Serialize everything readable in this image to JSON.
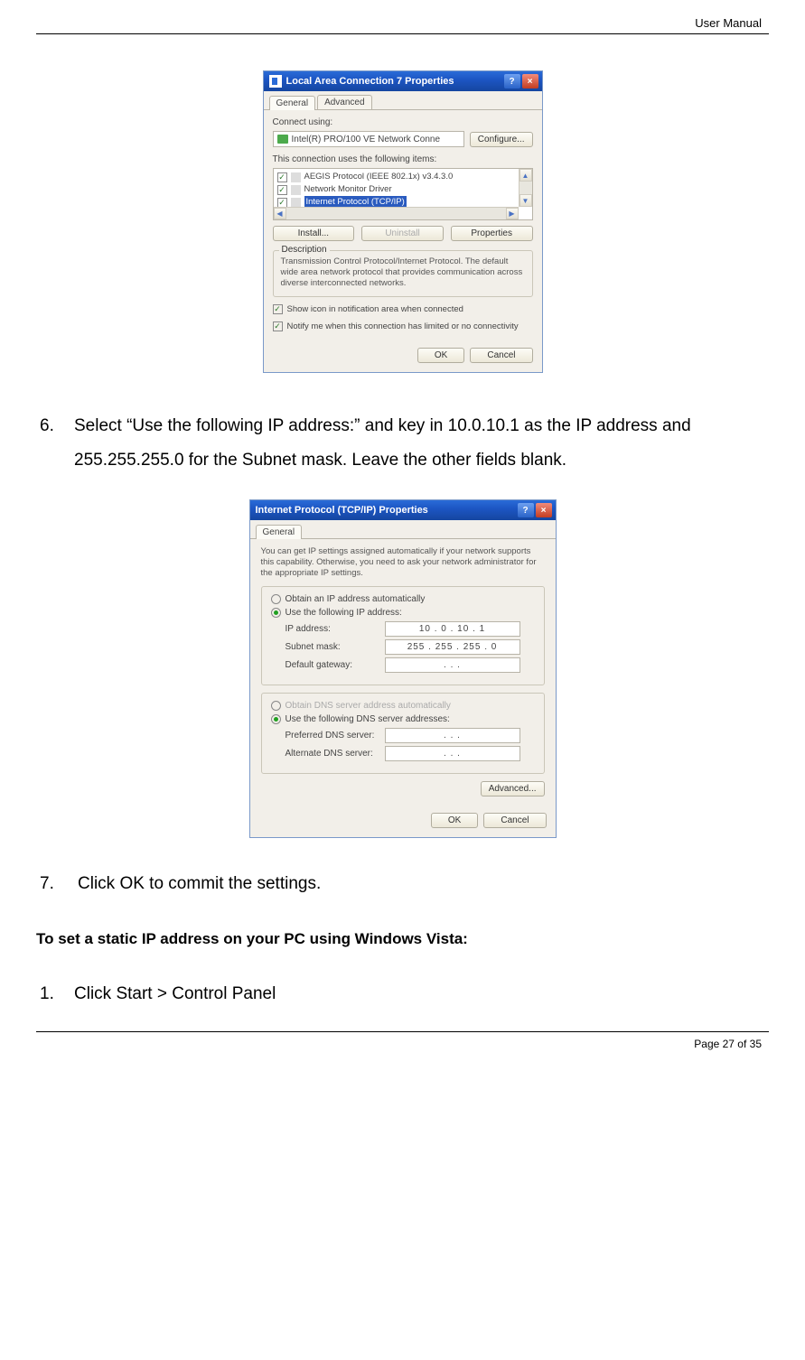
{
  "header": {
    "doc_title": "User Manual"
  },
  "footer": {
    "page_label": "Page 27 of 35"
  },
  "steps": {
    "six": {
      "num": "6.",
      "text": "Select “Use the following IP address:” and key in 10.0.10.1 as the IP address and 255.255.255.0 for the Subnet mask. Leave the other fields blank."
    },
    "seven": {
      "num": "7.",
      "text": "Click OK to commit the settings."
    },
    "one": {
      "num": "1.",
      "text": "Click Start > Control Panel"
    }
  },
  "section_heading": "To set a static IP address on your PC using Windows Vista:",
  "dialog1": {
    "title": "Local Area Connection 7 Properties",
    "help_glyph": "?",
    "close_glyph": "×",
    "tabs": {
      "general": "General",
      "advanced": "Advanced"
    },
    "connect_using_label": "Connect using:",
    "nic_text": "Intel(R) PRO/100 VE Network Conne",
    "configure_btn": "Configure...",
    "uses_items_label": "This connection uses the following items:",
    "items": {
      "a": "AEGIS Protocol (IEEE 802.1x) v3.4.3.0",
      "b": "Network Monitor Driver",
      "c": "Internet Protocol (TCP/IP)"
    },
    "install_btn": "Install...",
    "uninstall_btn": "Uninstall",
    "properties_btn": "Properties",
    "desc_title": "Description",
    "desc_text": "Transmission Control Protocol/Internet Protocol. The default wide area network protocol that provides communication across diverse interconnected networks.",
    "show_icon": "Show icon in notification area when connected",
    "notify": "Notify me when this connection has limited or no connectivity",
    "ok": "OK",
    "cancel": "Cancel",
    "check": "✓",
    "arrow_up": "▲",
    "arrow_down": "▼",
    "arrow_left": "◀",
    "arrow_right": "▶"
  },
  "dialog2": {
    "title": "Internet Protocol (TCP/IP) Properties",
    "help_glyph": "?",
    "close_glyph": "×",
    "tab_general": "General",
    "intro": "You can get IP settings assigned automatically if your network supports this capability. Otherwise, you need to ask your network administrator for the appropriate IP settings.",
    "r_obtain_ip": "Obtain an IP address automatically",
    "r_use_ip": "Use the following IP address:",
    "ip_label": "IP address:",
    "ip_value": "10  .  0  .  10  .  1",
    "subnet_label": "Subnet mask:",
    "subnet_value": "255 . 255 . 255 .  0",
    "gateway_label": "Default gateway:",
    "gateway_value": ".       .       .",
    "r_obtain_dns": "Obtain DNS server address automatically",
    "r_use_dns": "Use the following DNS server addresses:",
    "pref_dns_label": "Preferred DNS server:",
    "pref_dns_value": ".       .       .",
    "alt_dns_label": "Alternate DNS server:",
    "alt_dns_value": ".       .       .",
    "advanced_btn": "Advanced...",
    "ok": "OK",
    "cancel": "Cancel"
  }
}
